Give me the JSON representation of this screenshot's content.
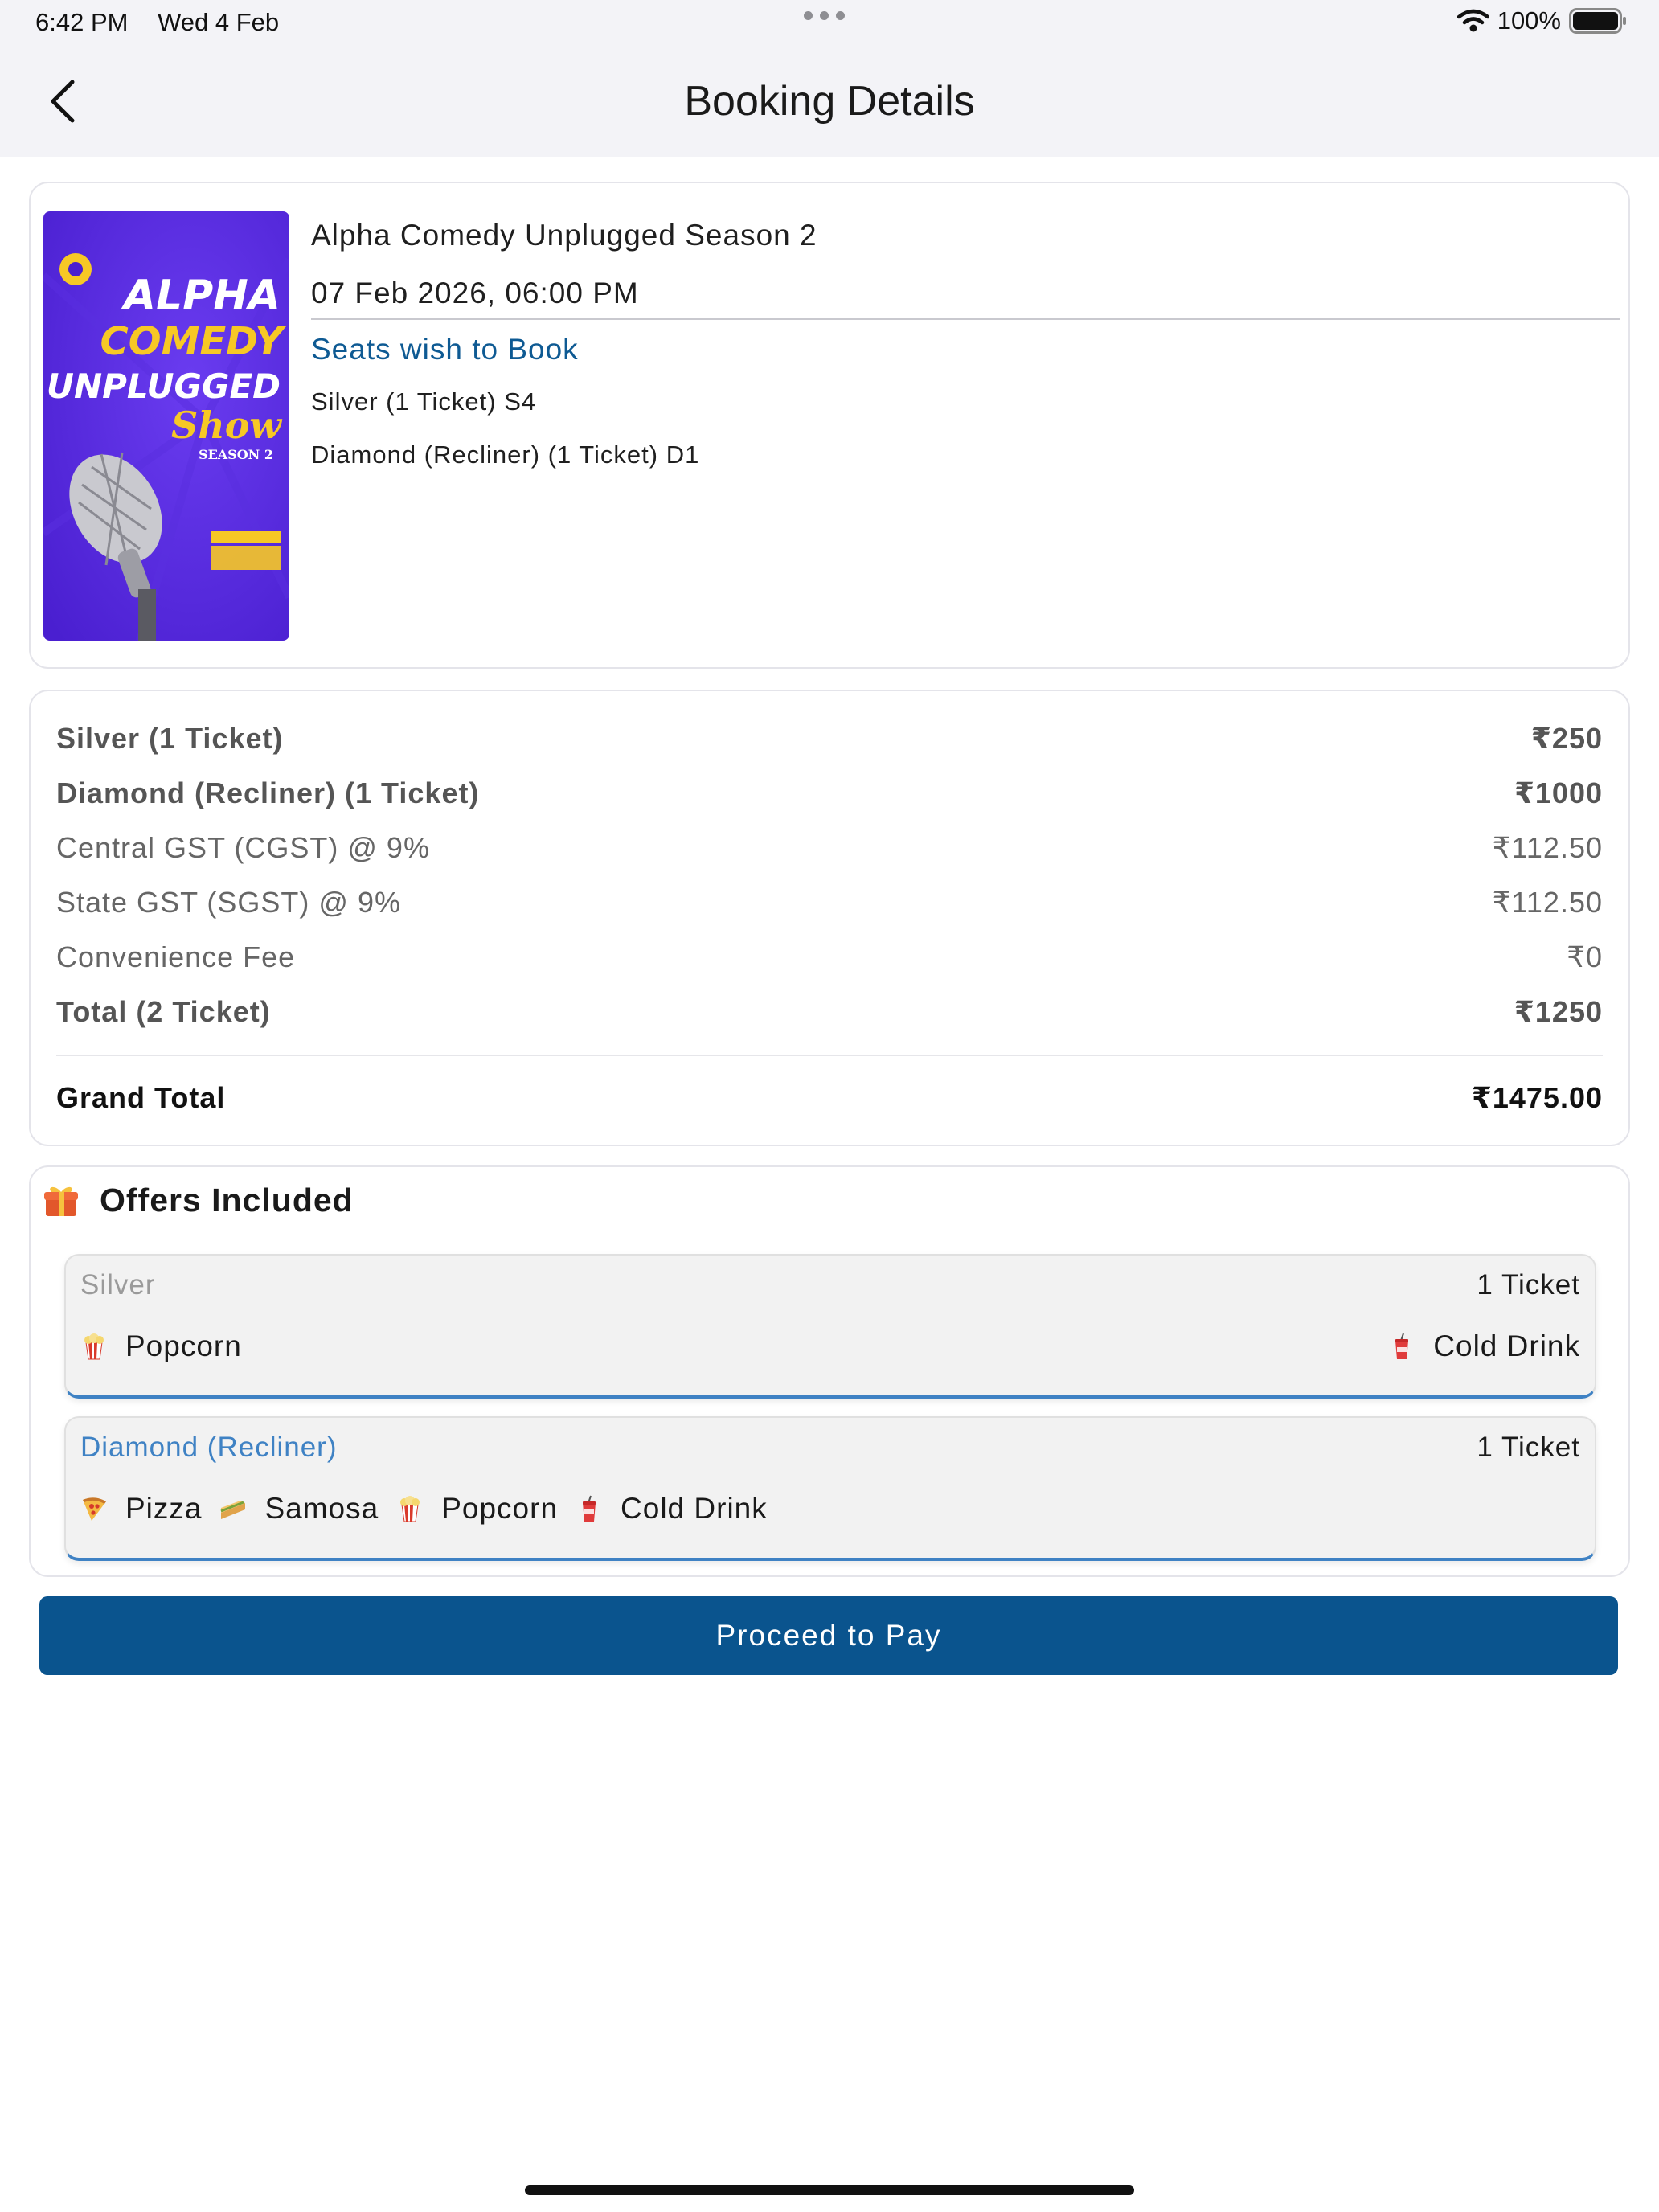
{
  "status_bar": {
    "time": "6:42 PM",
    "date": "Wed 4 Feb",
    "battery": "100%"
  },
  "nav": {
    "title": "Booking Details"
  },
  "event": {
    "poster_lines": [
      "ALPHA",
      "COMEDY",
      "UNPLUGGED",
      "Show",
      "SEASON 2"
    ],
    "title": "Alpha Comedy Unplugged Season 2",
    "datetime": "07 Feb 2026, 06:00 PM",
    "seats_heading": "Seats wish to Book",
    "seats": [
      "Silver (1 Ticket) S4",
      "Diamond (Recliner) (1 Ticket) D1"
    ]
  },
  "pricing": {
    "rows": [
      {
        "label": "Silver (1 Ticket)",
        "value": "₹250"
      },
      {
        "label": "Diamond (Recliner) (1 Ticket)",
        "value": "₹1000"
      },
      {
        "label": "Central GST (CGST) @ 9%",
        "value": "₹112.50"
      },
      {
        "label": "State GST (SGST) @ 9%",
        "value": "₹112.50"
      },
      {
        "label": "Convenience Fee",
        "value": "₹0"
      },
      {
        "label": "Total (2 Ticket)",
        "value": "₹1250"
      }
    ],
    "grand_total_label": "Grand Total",
    "grand_total_value": "₹1475.00"
  },
  "offers": {
    "heading": "Offers Included",
    "groups": [
      {
        "tier": "Silver",
        "tier_color": "#9a9a9a",
        "count": "1 Ticket",
        "items": [
          "Popcorn",
          "Cold Drink"
        ]
      },
      {
        "tier": "Diamond (Recliner)",
        "tier_color": "#3f82c4",
        "count": "1 Ticket",
        "items": [
          "Pizza",
          "Samosa",
          "Popcorn",
          "Cold Drink"
        ]
      }
    ]
  },
  "actions": {
    "pay_label": "Proceed to Pay"
  },
  "colors": {
    "accent": "#0a548e",
    "link": "#0e5a93",
    "offer_border": "#3f82c4"
  }
}
